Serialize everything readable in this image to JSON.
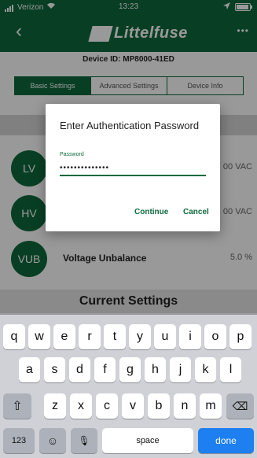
{
  "status_bar": {
    "carrier": "Verizon",
    "time": "13:23"
  },
  "nav": {
    "back_glyph": "‹",
    "logo_text": "Littelfuse",
    "more_glyph": "•••"
  },
  "device_id": "Device ID: MP8000-41ED",
  "tabs": [
    {
      "label": "Basic Settings",
      "active": true
    },
    {
      "label": "Advanced Settings",
      "active": false
    },
    {
      "label": "Device Info",
      "active": false
    }
  ],
  "settings": [
    {
      "badge": "LV",
      "label": "",
      "value": "00 VAC"
    },
    {
      "badge": "HV",
      "label": "",
      "value": "00 VAC"
    },
    {
      "badge": "VUB",
      "label": "Voltage Unbalance",
      "value": "5.0 %"
    }
  ],
  "section_title": "Current Settings",
  "dialog": {
    "title": "Enter Authentication Password",
    "field_label": "Password",
    "field_value": "••••••••••••••",
    "continue_label": "Continue",
    "cancel_label": "Cancel"
  },
  "keyboard": {
    "row1": [
      "q",
      "w",
      "e",
      "r",
      "t",
      "y",
      "u",
      "i",
      "o",
      "p"
    ],
    "row2": [
      "a",
      "s",
      "d",
      "f",
      "g",
      "h",
      "j",
      "k",
      "l"
    ],
    "row3": [
      "z",
      "x",
      "c",
      "v",
      "b",
      "n",
      "m"
    ],
    "shift_glyph": "⇧",
    "backspace_glyph": "⌫",
    "numbers_label": "123",
    "emoji_glyph": "☺",
    "mic_glyph": "🎙",
    "space_label": "space",
    "done_label": "done"
  },
  "colors": {
    "brand": "#0e6a3c",
    "accent_done": "#1e7ff0"
  }
}
